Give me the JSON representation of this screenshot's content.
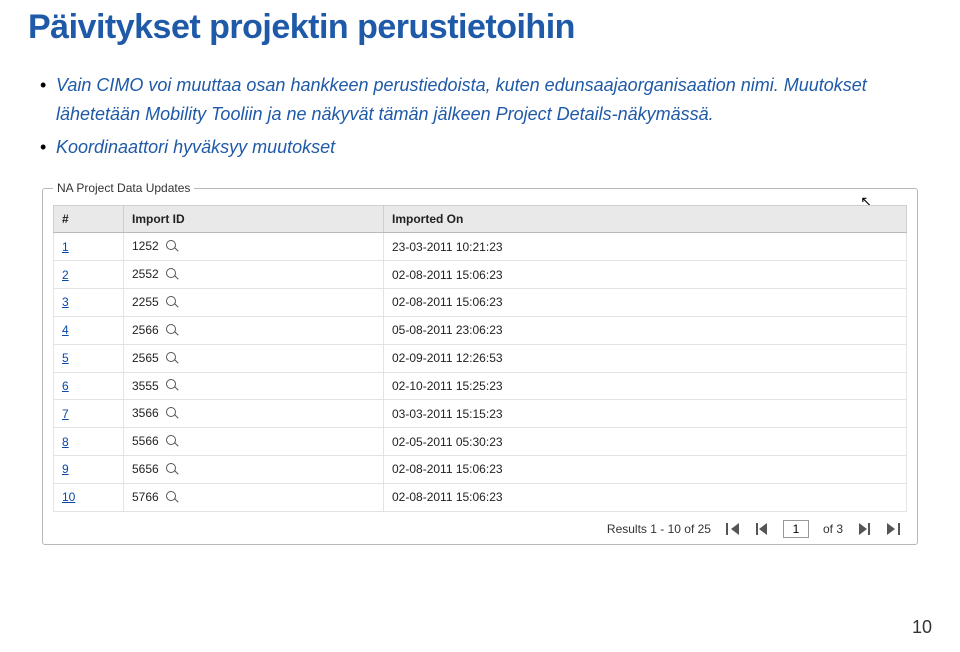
{
  "title": "Päivitykset projektin perustietoihin",
  "bullets": [
    "Vain CIMO voi muuttaa osan hankkeen perustiedoista, kuten edunsaajaorganisaation nimi. Muutokset lähetetään Mobility Tooliin ja ne näkyvät tämän jälkeen Project Details-näkymässä.",
    "Koordinaattori hyväksyy muutokset"
  ],
  "legend": "NA Project Data Updates",
  "columns": {
    "idx": "#",
    "import_id": "Import ID",
    "imported_on": "Imported On"
  },
  "rows": [
    {
      "n": "1",
      "id": "1252",
      "ts": "23-03-2011 10:21:23"
    },
    {
      "n": "2",
      "id": "2552",
      "ts": "02-08-2011 15:06:23"
    },
    {
      "n": "3",
      "id": "2255",
      "ts": "02-08-2011 15:06:23"
    },
    {
      "n": "4",
      "id": "2566",
      "ts": "05-08-2011 23:06:23"
    },
    {
      "n": "5",
      "id": "2565",
      "ts": "02-09-2011 12:26:53"
    },
    {
      "n": "6",
      "id": "3555",
      "ts": "02-10-2011 15:25:23"
    },
    {
      "n": "7",
      "id": "3566",
      "ts": "03-03-2011 15:15:23"
    },
    {
      "n": "8",
      "id": "5566",
      "ts": "02-05-2011 05:30:23"
    },
    {
      "n": "9",
      "id": "5656",
      "ts": "02-08-2011 15:06:23"
    },
    {
      "n": "10",
      "id": "5766",
      "ts": "02-08-2011 15:06:23"
    }
  ],
  "pager": {
    "results": "Results 1 - 10 of 25",
    "page": "1",
    "of_label": "of 3"
  },
  "slide_number": "10"
}
